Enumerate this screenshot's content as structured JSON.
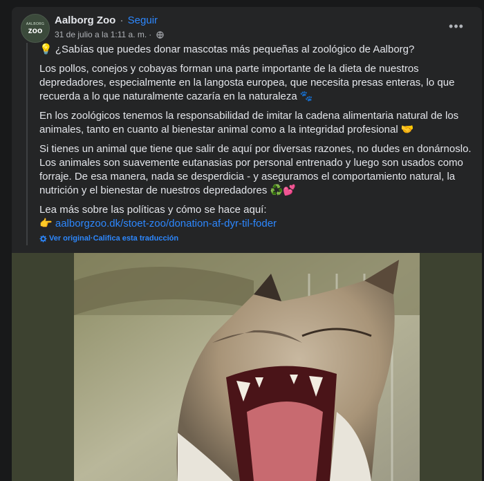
{
  "post": {
    "page_name": "Aalborg Zoo",
    "separator": "·",
    "follow_label": "Seguir",
    "timestamp": "31 de julio a la 1:11 a. m.",
    "meta_separator": "·",
    "avatar_text_small": "AALBORG",
    "avatar_text_big": "zoo",
    "more_label": "•••",
    "paragraphs": [
      "💡 ¿Sabías que puedes donar mascotas más pequeñas al zoológico de Aalborg?",
      "Los pollos, conejos y cobayas forman una parte importante de la dieta de nuestros depredadores, especialmente en la langosta europea, que necesita presas enteras, lo que recuerda a lo que naturalmente cazaría en la naturaleza 🐾",
      "En los zoológicos tenemos la responsabilidad de imitar la cadena alimentaria natural de los animales, tanto en cuanto al bienestar animal como a la integridad profesional 🤝",
      "Si tienes un animal que tiene que salir de aquí por diversas razones, no dudes en donárnoslo. Los animales son suavemente eutanasias por personal entrenado y luego son usados como forraje. De esa manera, nada se desperdicia - y aseguramos el comportamiento natural, la nutrición y el bienestar de nuestros depredadores ♻️💕"
    ],
    "read_more": "Lea más sobre las políticas y cómo se hace aquí:",
    "link_emoji": "👉",
    "link_text": "aalborgzoo.dk/stoet-zoo/donation-af-dyr-til-foder",
    "see_original": "Ver original",
    "translation_separator": " · ",
    "rate_translation": "Califica esta traducción"
  },
  "colors": {
    "background": "#18191a",
    "card": "#242526",
    "text": "#e4e6eb",
    "secondary": "#b0b3b8",
    "link": "#2d88ff"
  },
  "icons": [
    "globe-icon",
    "more-icon",
    "gear-icon",
    "lynx-photo"
  ]
}
